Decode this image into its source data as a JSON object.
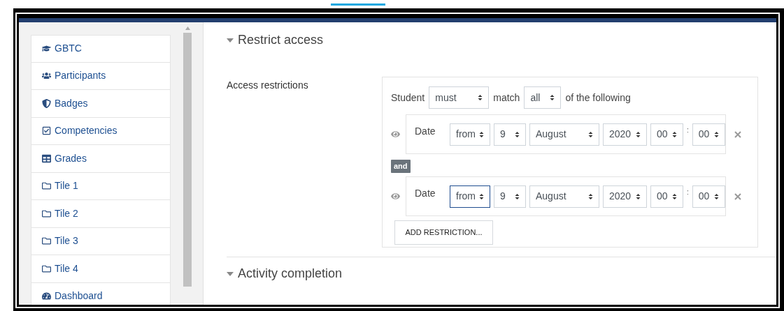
{
  "sidebar": {
    "items": [
      {
        "label": "GBTC",
        "kind": "course"
      },
      {
        "label": "Participants",
        "kind": "participants"
      },
      {
        "label": "Badges",
        "kind": "badges"
      },
      {
        "label": "Competencies",
        "kind": "competencies"
      },
      {
        "label": "Grades",
        "kind": "grades"
      },
      {
        "label": "Tile 1",
        "kind": "section"
      },
      {
        "label": "Tile 2",
        "kind": "section"
      },
      {
        "label": "Tile 3",
        "kind": "section"
      },
      {
        "label": "Tile 4",
        "kind": "section"
      },
      {
        "label": "Dashboard",
        "kind": "dashboard"
      }
    ]
  },
  "sections": [
    {
      "title": "Restrict access",
      "expanded": true
    },
    {
      "title": "Activity completion",
      "expanded": true
    }
  ],
  "access": {
    "label": "Access restrictions",
    "header": {
      "prefix": "Student",
      "must": "must",
      "match_label": "match",
      "match": "all",
      "suffix": "of the following"
    },
    "restrictions": [
      {
        "kind": "date",
        "label": "Date",
        "direction": {
          "value": "from",
          "focused": false
        },
        "day": "9",
        "month": "August",
        "year": "2020",
        "hour": "00",
        "separator": ":",
        "minute": "00"
      },
      {
        "kind": "date",
        "label": "Date",
        "direction": {
          "value": "from",
          "focused": true
        },
        "day": "9",
        "month": "August",
        "year": "2020",
        "hour": "00",
        "separator": ":",
        "minute": "00"
      }
    ],
    "connector": "and",
    "add_button": "ADD RESTRICTION..."
  }
}
